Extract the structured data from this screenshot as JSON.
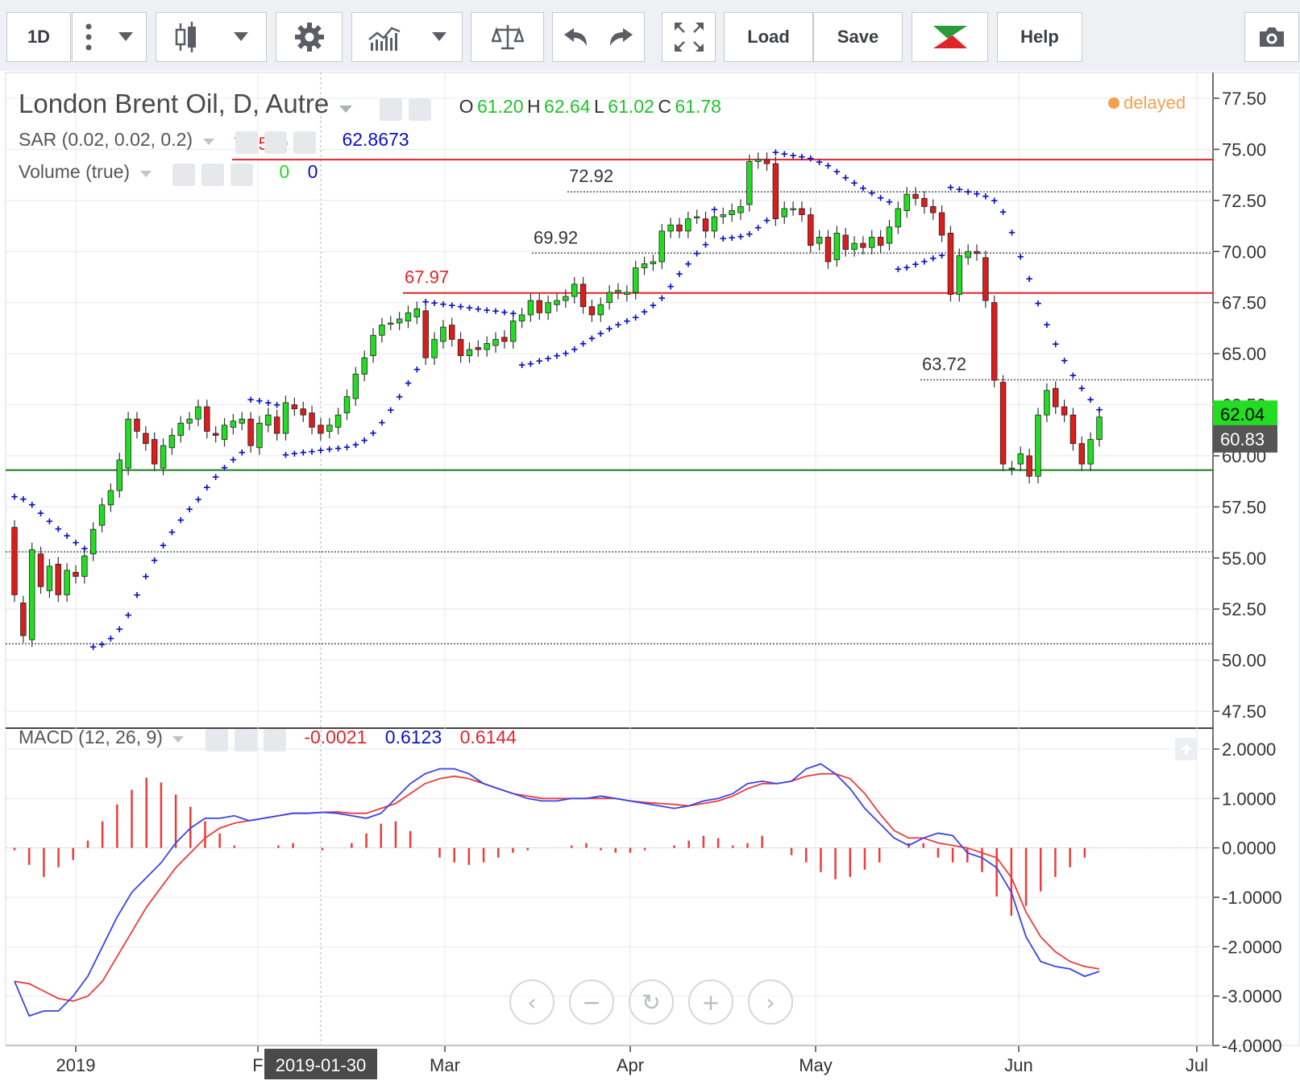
{
  "toolbar": {
    "interval": "1D",
    "load_label": "Load",
    "save_label": "Save",
    "help_label": "Help",
    "icons": [
      "more-vert-icon",
      "chevron-down-icon",
      "candlestick-icon",
      "chevron-down-icon",
      "gear-icon",
      "indicators-icon",
      "chevron-down-icon",
      "compare-scale-icon",
      "undo-icon",
      "redo-icon",
      "fullscreen-icon",
      "brand-logo-icon",
      "camera-icon"
    ]
  },
  "header": {
    "title": "London Brent Oil, D, Autre",
    "ohlc": {
      "o_label": "O",
      "o": "61.20",
      "h_label": "H",
      "h": "62.64",
      "l_label": "L",
      "l": "61.02",
      "c_label": "C",
      "c": "61.78"
    },
    "delayed": "delayed",
    "sar_label": "SAR (0.02, 0.02, 0.2)",
    "sar_value": "62.8673",
    "volume_label": "Volume (true)",
    "volume_up": "0",
    "volume_down": "0",
    "macd_label": "MACD (12, 26, 9)",
    "macd_hist_value": "-0.0021",
    "macd_value": "0.6123",
    "macd_signal_value": "0.6144"
  },
  "crosshair_date": "2019-01-30",
  "colors": {
    "up": "#22dd22",
    "down": "#dd1c1c",
    "sar": "#0a12c8",
    "macd": "#3a44e8",
    "signal": "#ee3b3b",
    "grid": "#e6e8ec",
    "axis": "#333333",
    "hline_red": "#e0242c",
    "hline_green": "#1a7a1a",
    "delayed": "#f5a04a"
  },
  "chart_data": {
    "type": "candlestick",
    "title": "London Brent Oil, D, Autre",
    "price_axis": {
      "ylim": [
        47.5,
        77.5
      ],
      "ticks": [
        "77.50",
        "75.00",
        "72.50",
        "70.00",
        "67.50",
        "65.00",
        "62.50",
        "60.00",
        "57.50",
        "55.00",
        "52.50",
        "50.00",
        "47.50"
      ]
    },
    "price_badges": [
      {
        "value": "62.04",
        "color": "#22dd22"
      },
      {
        "value": "60.83",
        "color": "#555555"
      }
    ],
    "time_axis": {
      "labels": [
        "2019",
        "F",
        "Mar",
        "Apr",
        "May",
        "Jun",
        "Jul"
      ]
    },
    "levels": [
      {
        "label": "74.500",
        "value": 74.5,
        "style": "solid-red"
      },
      {
        "label": "72.92",
        "value": 72.92,
        "style": "dotted"
      },
      {
        "label": "69.92",
        "value": 69.92,
        "style": "dotted"
      },
      {
        "label": "67.97",
        "value": 67.97,
        "style": "solid-red"
      },
      {
        "label": "63.72",
        "value": 63.72,
        "style": "dotted"
      },
      {
        "label": "",
        "value": 59.3,
        "style": "solid-green"
      },
      {
        "label": "",
        "value": 55.3,
        "style": "dotted"
      },
      {
        "label": "",
        "value": 50.8,
        "style": "dotted"
      }
    ],
    "candles": [
      [
        56.5,
        53.2
      ],
      [
        52.8,
        51.2
      ],
      [
        51.0,
        55.4
      ],
      [
        55.2,
        53.6
      ],
      [
        53.4,
        54.6
      ],
      [
        54.7,
        53.2
      ],
      [
        53.2,
        54.4
      ],
      [
        54.3,
        54.1
      ],
      [
        54.1,
        55.1
      ],
      [
        55.2,
        56.4
      ],
      [
        56.6,
        57.6
      ],
      [
        57.6,
        58.3
      ],
      [
        58.3,
        59.8
      ],
      [
        59.4,
        61.8
      ],
      [
        61.8,
        61.2
      ],
      [
        61.1,
        60.6
      ],
      [
        60.8,
        59.6
      ],
      [
        59.4,
        60.5
      ],
      [
        60.4,
        61.0
      ],
      [
        61.0,
        61.6
      ],
      [
        61.6,
        61.8
      ],
      [
        61.8,
        62.4
      ],
      [
        62.4,
        61.2
      ],
      [
        61.1,
        61.0
      ],
      [
        60.8,
        61.5
      ],
      [
        61.4,
        61.7
      ],
      [
        61.6,
        61.8
      ],
      [
        61.8,
        60.5
      ],
      [
        60.4,
        61.6
      ],
      [
        61.5,
        62.0
      ],
      [
        61.9,
        61.1
      ],
      [
        61.1,
        62.6
      ],
      [
        62.5,
        62.3
      ],
      [
        62.3,
        62.0
      ],
      [
        62.1,
        61.4
      ],
      [
        61.5,
        61.1
      ],
      [
        61.2,
        61.5
      ],
      [
        61.4,
        62.0
      ],
      [
        62.1,
        62.9
      ],
      [
        62.8,
        64.0
      ],
      [
        64.0,
        64.8
      ],
      [
        64.9,
        65.9
      ],
      [
        65.9,
        66.4
      ],
      [
        66.5,
        66.5
      ],
      [
        66.5,
        66.7
      ],
      [
        66.6,
        67.0
      ],
      [
        66.8,
        67.2
      ],
      [
        67.1,
        64.8
      ],
      [
        64.8,
        65.7
      ],
      [
        65.6,
        66.3
      ],
      [
        66.4,
        65.7
      ],
      [
        65.7,
        64.9
      ],
      [
        64.9,
        65.2
      ],
      [
        65.3,
        65.2
      ],
      [
        65.2,
        65.5
      ],
      [
        65.4,
        65.7
      ],
      [
        65.8,
        65.6
      ],
      [
        65.6,
        66.6
      ],
      [
        66.6,
        66.9
      ],
      [
        66.9,
        67.6
      ],
      [
        67.6,
        67.0
      ],
      [
        67.0,
        67.5
      ],
      [
        67.4,
        67.6
      ],
      [
        67.6,
        67.8
      ],
      [
        67.8,
        68.4
      ],
      [
        68.4,
        67.3
      ],
      [
        67.3,
        66.9
      ],
      [
        66.9,
        67.4
      ],
      [
        67.5,
        68.0
      ],
      [
        68.0,
        68.1
      ],
      [
        67.9,
        68.0
      ],
      [
        68.0,
        69.2
      ],
      [
        69.2,
        69.4
      ],
      [
        69.4,
        69.5
      ],
      [
        69.5,
        71.0
      ],
      [
        71.0,
        71.3
      ],
      [
        71.3,
        71.0
      ],
      [
        71.0,
        71.6
      ],
      [
        71.7,
        71.7
      ],
      [
        71.6,
        71.0
      ],
      [
        71.0,
        71.7
      ],
      [
        71.7,
        71.8
      ],
      [
        71.8,
        72.0
      ],
      [
        71.9,
        72.2
      ],
      [
        72.3,
        74.4
      ],
      [
        74.4,
        74.5
      ],
      [
        74.5,
        74.3
      ],
      [
        74.3,
        71.6
      ],
      [
        71.7,
        72.1
      ],
      [
        72.1,
        72.1
      ],
      [
        72.1,
        71.8
      ],
      [
        71.8,
        70.3
      ],
      [
        70.4,
        70.7
      ],
      [
        70.7,
        69.5
      ],
      [
        69.6,
        70.9
      ],
      [
        70.8,
        70.1
      ],
      [
        70.1,
        70.4
      ],
      [
        70.4,
        70.2
      ],
      [
        70.2,
        70.7
      ],
      [
        70.7,
        70.3
      ],
      [
        70.4,
        71.2
      ],
      [
        71.2,
        72.1
      ],
      [
        72.0,
        72.8
      ],
      [
        72.8,
        72.6
      ],
      [
        72.6,
        72.2
      ],
      [
        72.2,
        71.9
      ],
      [
        71.9,
        70.8
      ],
      [
        70.9,
        67.9
      ],
      [
        67.9,
        69.8
      ],
      [
        69.7,
        70.0
      ],
      [
        70.0,
        69.9
      ],
      [
        69.7,
        67.6
      ],
      [
        67.5,
        63.7
      ],
      [
        63.6,
        59.6
      ],
      [
        59.4,
        59.4
      ],
      [
        59.6,
        60.1
      ],
      [
        60.0,
        59.0
      ],
      [
        59.0,
        62.0
      ],
      [
        62.0,
        63.2
      ],
      [
        63.3,
        62.4
      ],
      [
        62.4,
        62.0
      ],
      [
        62.0,
        60.6
      ],
      [
        60.6,
        59.6
      ],
      [
        59.6,
        60.8
      ],
      [
        60.8,
        61.9
      ]
    ],
    "sar": [],
    "volume": {
      "up": "0",
      "down": "0"
    },
    "macd": {
      "axis": {
        "ylim": [
          -4,
          2
        ],
        "ticks": [
          "2.0000",
          "1.0000",
          "0.0000",
          "-1.0000",
          "-2.0000",
          "-3.0000",
          "-4.0000"
        ]
      },
      "macd_line": [
        -2.7,
        -3.4,
        -3.3,
        -3.3,
        -3.0,
        -2.6,
        -2.0,
        -1.4,
        -0.9,
        -0.6,
        -0.3,
        0.1,
        0.4,
        0.6,
        0.6,
        0.65,
        0.55,
        0.6,
        0.65,
        0.7,
        0.7,
        0.72,
        0.7,
        0.65,
        0.6,
        0.7,
        1.0,
        1.3,
        1.5,
        1.6,
        1.6,
        1.5,
        1.3,
        1.2,
        1.1,
        1.0,
        0.95,
        0.95,
        1.0,
        1.0,
        1.05,
        1.0,
        0.95,
        0.9,
        0.85,
        0.8,
        0.85,
        0.95,
        1.0,
        1.1,
        1.3,
        1.35,
        1.3,
        1.35,
        1.6,
        1.7,
        1.5,
        1.2,
        0.8,
        0.5,
        0.2,
        0.05,
        0.2,
        0.3,
        0.25,
        -0.1,
        -0.2,
        -0.4,
        -0.9,
        -1.8,
        -2.3,
        -2.4,
        -2.45,
        -2.6,
        -2.5
      ],
      "signal_line": [
        -2.7,
        -2.75,
        -2.9,
        -3.05,
        -3.1,
        -3.0,
        -2.7,
        -2.2,
        -1.7,
        -1.2,
        -0.8,
        -0.4,
        -0.1,
        0.2,
        0.4,
        0.5,
        0.55,
        0.6,
        0.65,
        0.7,
        0.7,
        0.72,
        0.73,
        0.7,
        0.7,
        0.8,
        0.9,
        1.1,
        1.3,
        1.4,
        1.45,
        1.4,
        1.3,
        1.2,
        1.1,
        1.05,
        1.0,
        1.0,
        1.0,
        1.0,
        1.0,
        1.0,
        0.95,
        0.92,
        0.9,
        0.88,
        0.85,
        0.9,
        0.95,
        1.05,
        1.2,
        1.3,
        1.3,
        1.35,
        1.45,
        1.5,
        1.5,
        1.4,
        1.1,
        0.7,
        0.35,
        0.2,
        0.2,
        0.1,
        0.05,
        0.0,
        -0.1,
        -0.2,
        -0.6,
        -1.3,
        -1.8,
        -2.1,
        -2.3,
        -2.4,
        -2.45
      ],
      "histogram": [
        -0.05,
        -0.35,
        -0.6,
        -0.4,
        -0.25,
        0.15,
        0.55,
        0.9,
        1.2,
        1.45,
        1.35,
        1.1,
        0.85,
        0.55,
        0.3,
        0.05,
        0.0,
        0.0,
        0.05,
        0.1,
        0.0,
        -0.05,
        0.0,
        0.1,
        0.3,
        0.5,
        0.55,
        0.35,
        0.0,
        -0.2,
        -0.3,
        -0.35,
        -0.3,
        -0.2,
        -0.1,
        -0.05,
        0.0,
        0.0,
        0.05,
        0.1,
        -0.05,
        -0.1,
        -0.1,
        -0.05,
        0.0,
        0.05,
        0.15,
        0.25,
        0.2,
        0.05,
        0.1,
        0.25,
        0.0,
        -0.15,
        -0.3,
        -0.5,
        -0.65,
        -0.6,
        -0.45,
        -0.3,
        0.0,
        0.1,
        0.1,
        -0.2,
        -0.3,
        -0.3,
        -0.5,
        -1.0,
        -1.4,
        -1.2,
        -0.9,
        -0.6,
        -0.4,
        -0.2,
        0.0
      ]
    }
  }
}
